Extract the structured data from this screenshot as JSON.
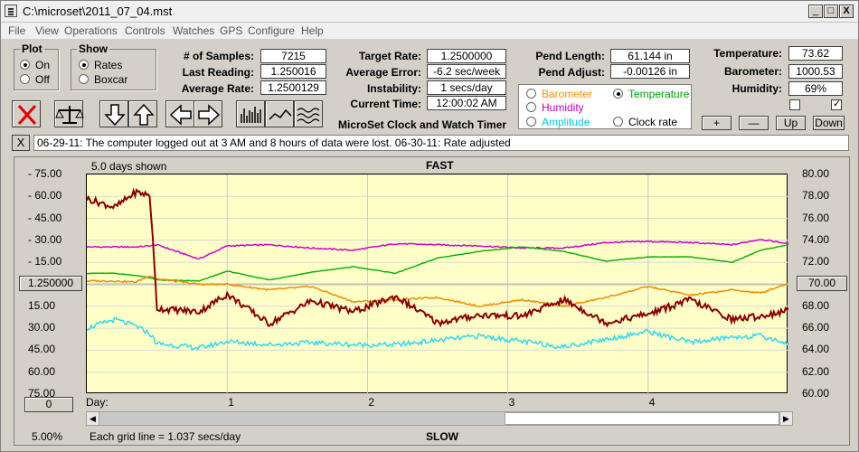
{
  "window": {
    "title": "C:\\microset\\2011_07_04.mst",
    "controls": [
      "_",
      "□",
      "X"
    ]
  },
  "menu": [
    "File",
    "View",
    "Operations",
    "Controls",
    "Watches",
    "GPS",
    "Configure",
    "Help"
  ],
  "plot_group": {
    "legend": "Plot",
    "options": [
      "On",
      "Off"
    ],
    "selected": "On"
  },
  "show_group": {
    "legend": "Show",
    "options": [
      "Rates",
      "Boxcar"
    ],
    "selected": "Rates"
  },
  "stats": {
    "samples_label": "# of Samples:",
    "samples": "7215",
    "last_label": "Last Reading:",
    "last": "1.250016",
    "avg_label": "Average Rate:",
    "avg": "1.2500129",
    "target_label": "Target Rate:",
    "target": "1.2500000",
    "err_label": "Average Error:",
    "err": "-6.2 sec/week",
    "inst_label": "Instability:",
    "inst": "1 secs/day",
    "time_label": "Current Time:",
    "time": "12:00:02 AM",
    "pend_len_label": "Pend Length:",
    "pend_len": "61.144 in",
    "pend_adj_label": "Pend Adjust:",
    "pend_adj": "-0.00126 in",
    "temp_label": "Temperature:",
    "temp": "73.62",
    "baro_label": "Barometer:",
    "baro": "1000.53",
    "hum_label": "Humidity:",
    "hum": "69%"
  },
  "app_name": "MicroSet Clock and Watch Timer",
  "series_select": {
    "options": [
      "Barometer",
      "Temperature",
      "Humidity",
      "Amplitude",
      "Clock rate"
    ],
    "selected": "Temperature",
    "colors": {
      "Barometer": "#ff8c00",
      "Temperature": "#00a000",
      "Humidity": "#c000c0",
      "Amplitude": "#00c8e0",
      "Clock rate": "#000000"
    }
  },
  "right_buttons": [
    "+",
    "—",
    "Up",
    "Down"
  ],
  "checkboxes": [
    false,
    true
  ],
  "message": "06-29-11: The computer logged out at 3 AM and 8 hours of data were lost.      06-30-11: Rate adjusted",
  "message_close": "X",
  "graph": {
    "days_shown": "5.0 days shown",
    "top_label": "FAST",
    "bottom_label": "SLOW",
    "day_label": "Day:",
    "left_center_value": "1.250000",
    "right_center_value": "70.00",
    "left_zero_btn": "0",
    "percent": "5.00%",
    "grid_note": "Each grid line = 1.037 secs/day"
  },
  "chart_data": {
    "type": "line",
    "left_ticks": [
      "75.00",
      "60.00",
      "45.00",
      "30.00",
      "15.00",
      "15.00",
      "30.00",
      "45.00",
      "60.00",
      "75.00"
    ],
    "right_ticks": [
      "80.00",
      "78.00",
      "76.00",
      "74.00",
      "72.00",
      "70.00",
      "68.00",
      "66.00",
      "64.00",
      "62.00",
      "60.00"
    ],
    "x_ticks": [
      "1",
      "2",
      "3",
      "4"
    ],
    "x": [
      0,
      0.2,
      0.35,
      0.45,
      0.5,
      0.8,
      1,
      1.3,
      1.6,
      1.9,
      2.2,
      2.5,
      2.8,
      3.1,
      3.4,
      3.7,
      4,
      4.3,
      4.6,
      4.8,
      5
    ],
    "series": [
      {
        "name": "Humidity",
        "color": "#d000d0",
        "values": [
          73.4,
          73.4,
          73.4,
          73.5,
          73.6,
          72.3,
          73.5,
          73.6,
          73.3,
          73.1,
          73.7,
          73.6,
          73.5,
          73.3,
          73.3,
          73.8,
          73.9,
          73.8,
          73.6,
          74.1,
          73.7
        ]
      },
      {
        "name": "Temperature",
        "color": "#10b010",
        "values": [
          71.0,
          71.0,
          70.8,
          70.6,
          70.4,
          70.3,
          71.2,
          70.4,
          71.1,
          71.6,
          71.0,
          72.4,
          73.0,
          73.4,
          73.0,
          72.1,
          72.5,
          72.5,
          72.0,
          73.1,
          73.6
        ]
      },
      {
        "name": "Barometer",
        "color": "#f08c00",
        "values": [
          70.3,
          70.3,
          70.2,
          70.8,
          70.5,
          70.0,
          70.0,
          69.5,
          69.8,
          68.4,
          68.6,
          68.8,
          68.0,
          68.6,
          68.0,
          68.8,
          69.8,
          69.0,
          69.5,
          69.2,
          70.1
        ]
      },
      {
        "name": "Clock rate",
        "color": "#8b0000",
        "values": [
          77.8,
          77.0,
          78.4,
          78.1,
          67.8,
          67.5,
          69.1,
          66.4,
          68.5,
          67.5,
          68.9,
          66.5,
          67.2,
          67.1,
          68.6,
          66.5,
          67.3,
          68.6,
          66.8,
          67.1,
          67.6
        ]
      },
      {
        "name": "Amplitude",
        "color": "#30d8f0",
        "values": [
          66.0,
          66.8,
          66.2,
          65.5,
          64.6,
          64.2,
          64.8,
          64.5,
          64.7,
          64.5,
          64.5,
          64.9,
          65.3,
          64.8,
          64.3,
          65.0,
          65.7,
          64.7,
          65.2,
          65.3,
          64.6
        ]
      }
    ],
    "y_right_range": [
      60,
      80
    ],
    "x_range": [
      0,
      5
    ],
    "grid": true
  }
}
